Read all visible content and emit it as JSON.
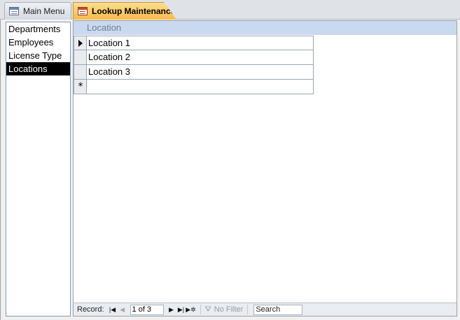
{
  "tabs": [
    {
      "label": "Main Menu",
      "icon": "form-icon",
      "active": false
    },
    {
      "label": "Lookup Maintenance",
      "icon": "form-icon",
      "active": true
    }
  ],
  "list": {
    "items": [
      "Departments",
      "Employees",
      "License Type",
      "Locations"
    ],
    "selected": "Locations"
  },
  "datasheet": {
    "column_header": "Location",
    "rows": [
      "Location 1",
      "Location 2",
      "Location 3"
    ],
    "current_row_marker": "current-record-arrow-icon",
    "new_row_marker": "*"
  },
  "navigation": {
    "record_label": "Record:",
    "current": "1 of 3",
    "filter_label": "No Filter",
    "search_placeholder": "Search"
  },
  "colors": {
    "active_tab": "#f9b94a",
    "header_band": "#c9d9ef",
    "selected_item": "#000000"
  }
}
